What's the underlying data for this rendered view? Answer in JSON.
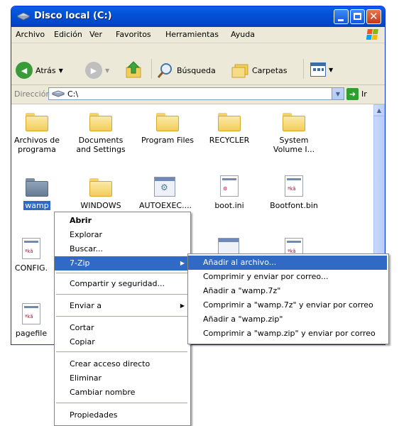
{
  "window": {
    "title": "Disco local (C:)"
  },
  "menubar": [
    "Archivo",
    "Edición",
    "Ver",
    "Favoritos",
    "Herramientas",
    "Ayuda"
  ],
  "toolbar": {
    "back": "Atrás",
    "search": "Búsqueda",
    "folders": "Carpetas"
  },
  "address": {
    "label": "Dirección",
    "value": "C:\\",
    "go": "Ir"
  },
  "files": [
    {
      "label": "Archivos de programa",
      "type": "folder"
    },
    {
      "label": "Documents and Settings",
      "type": "folder"
    },
    {
      "label": "Program Files",
      "type": "folder"
    },
    {
      "label": "RECYCLER",
      "type": "folder"
    },
    {
      "label": "System Volume I...",
      "type": "folder"
    },
    {
      "label": "wamp",
      "type": "folder-dark",
      "selected": true
    },
    {
      "label": "WINDOWS",
      "type": "folder"
    },
    {
      "label": "AUTOEXEC....",
      "type": "app"
    },
    {
      "label": "boot.ini",
      "type": "doc"
    },
    {
      "label": "Bootfont.bin",
      "type": "doc"
    },
    {
      "label": "CONFIG.",
      "type": "doc"
    },
    {
      "label": "pagefile",
      "type": "doc"
    }
  ],
  "context_menu": [
    {
      "label": "Abrir",
      "bold": true
    },
    {
      "label": "Explorar"
    },
    {
      "label": "Buscar..."
    },
    {
      "label": "7-Zip",
      "submenu": true,
      "highlighted": true
    },
    {
      "label": "Compartir y seguridad..."
    },
    {
      "label": "Enviar a",
      "submenu": true
    },
    {
      "label": "Cortar"
    },
    {
      "label": "Copiar"
    },
    {
      "label": "Crear acceso directo"
    },
    {
      "label": "Eliminar"
    },
    {
      "label": "Cambiar nombre"
    },
    {
      "label": "Propiedades"
    }
  ],
  "submenu_7zip": [
    {
      "label": "Añadir al archivo...",
      "highlighted": true
    },
    {
      "label": "Comprimir y enviar por correo..."
    },
    {
      "label": "Añadir a \"wamp.7z\""
    },
    {
      "label": "Comprimir a \"wamp.7z\" y enviar por correo"
    },
    {
      "label": "Añadir a \"wamp.zip\""
    },
    {
      "label": "Comprimir a \"wamp.zip\" y enviar por correo"
    }
  ],
  "colors": {
    "titlebar": "#0451d6",
    "highlight": "#316ac5",
    "window_bg": "#ece9d8"
  }
}
